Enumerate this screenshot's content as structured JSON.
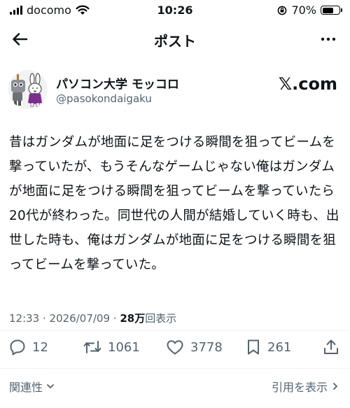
{
  "status_bar": {
    "carrier": "docomo",
    "time": "10:26",
    "battery_text": "70%",
    "battery_level": 0.7
  },
  "nav": {
    "title": "ポスト"
  },
  "author": {
    "name": "パソコン大学 モッコロ",
    "handle": "@pasokondaigaku",
    "source": "𝕏.com"
  },
  "tweet": {
    "text": "昔はガンダムが地面に足をつける瞬間を狙ってビームを撃っていたが、もうそんなゲームじゃない俺はガンダムが地面に足をつける瞬間を狙ってビームを撃っていたら20代が終わった。同世代の人間が結婚していく時も、出世した時も、俺はガンダムが地面に足をつける瞬間を狙ってビームを撃っていた。",
    "time": "12:33",
    "date": "2026/07/09",
    "views_count": "28万",
    "views_label": "回表示"
  },
  "actions": {
    "replies": "12",
    "retweets": "1061",
    "likes": "3778",
    "bookmarks": "261"
  },
  "footer": {
    "related": "関連性",
    "quotes": "引用を表示"
  }
}
